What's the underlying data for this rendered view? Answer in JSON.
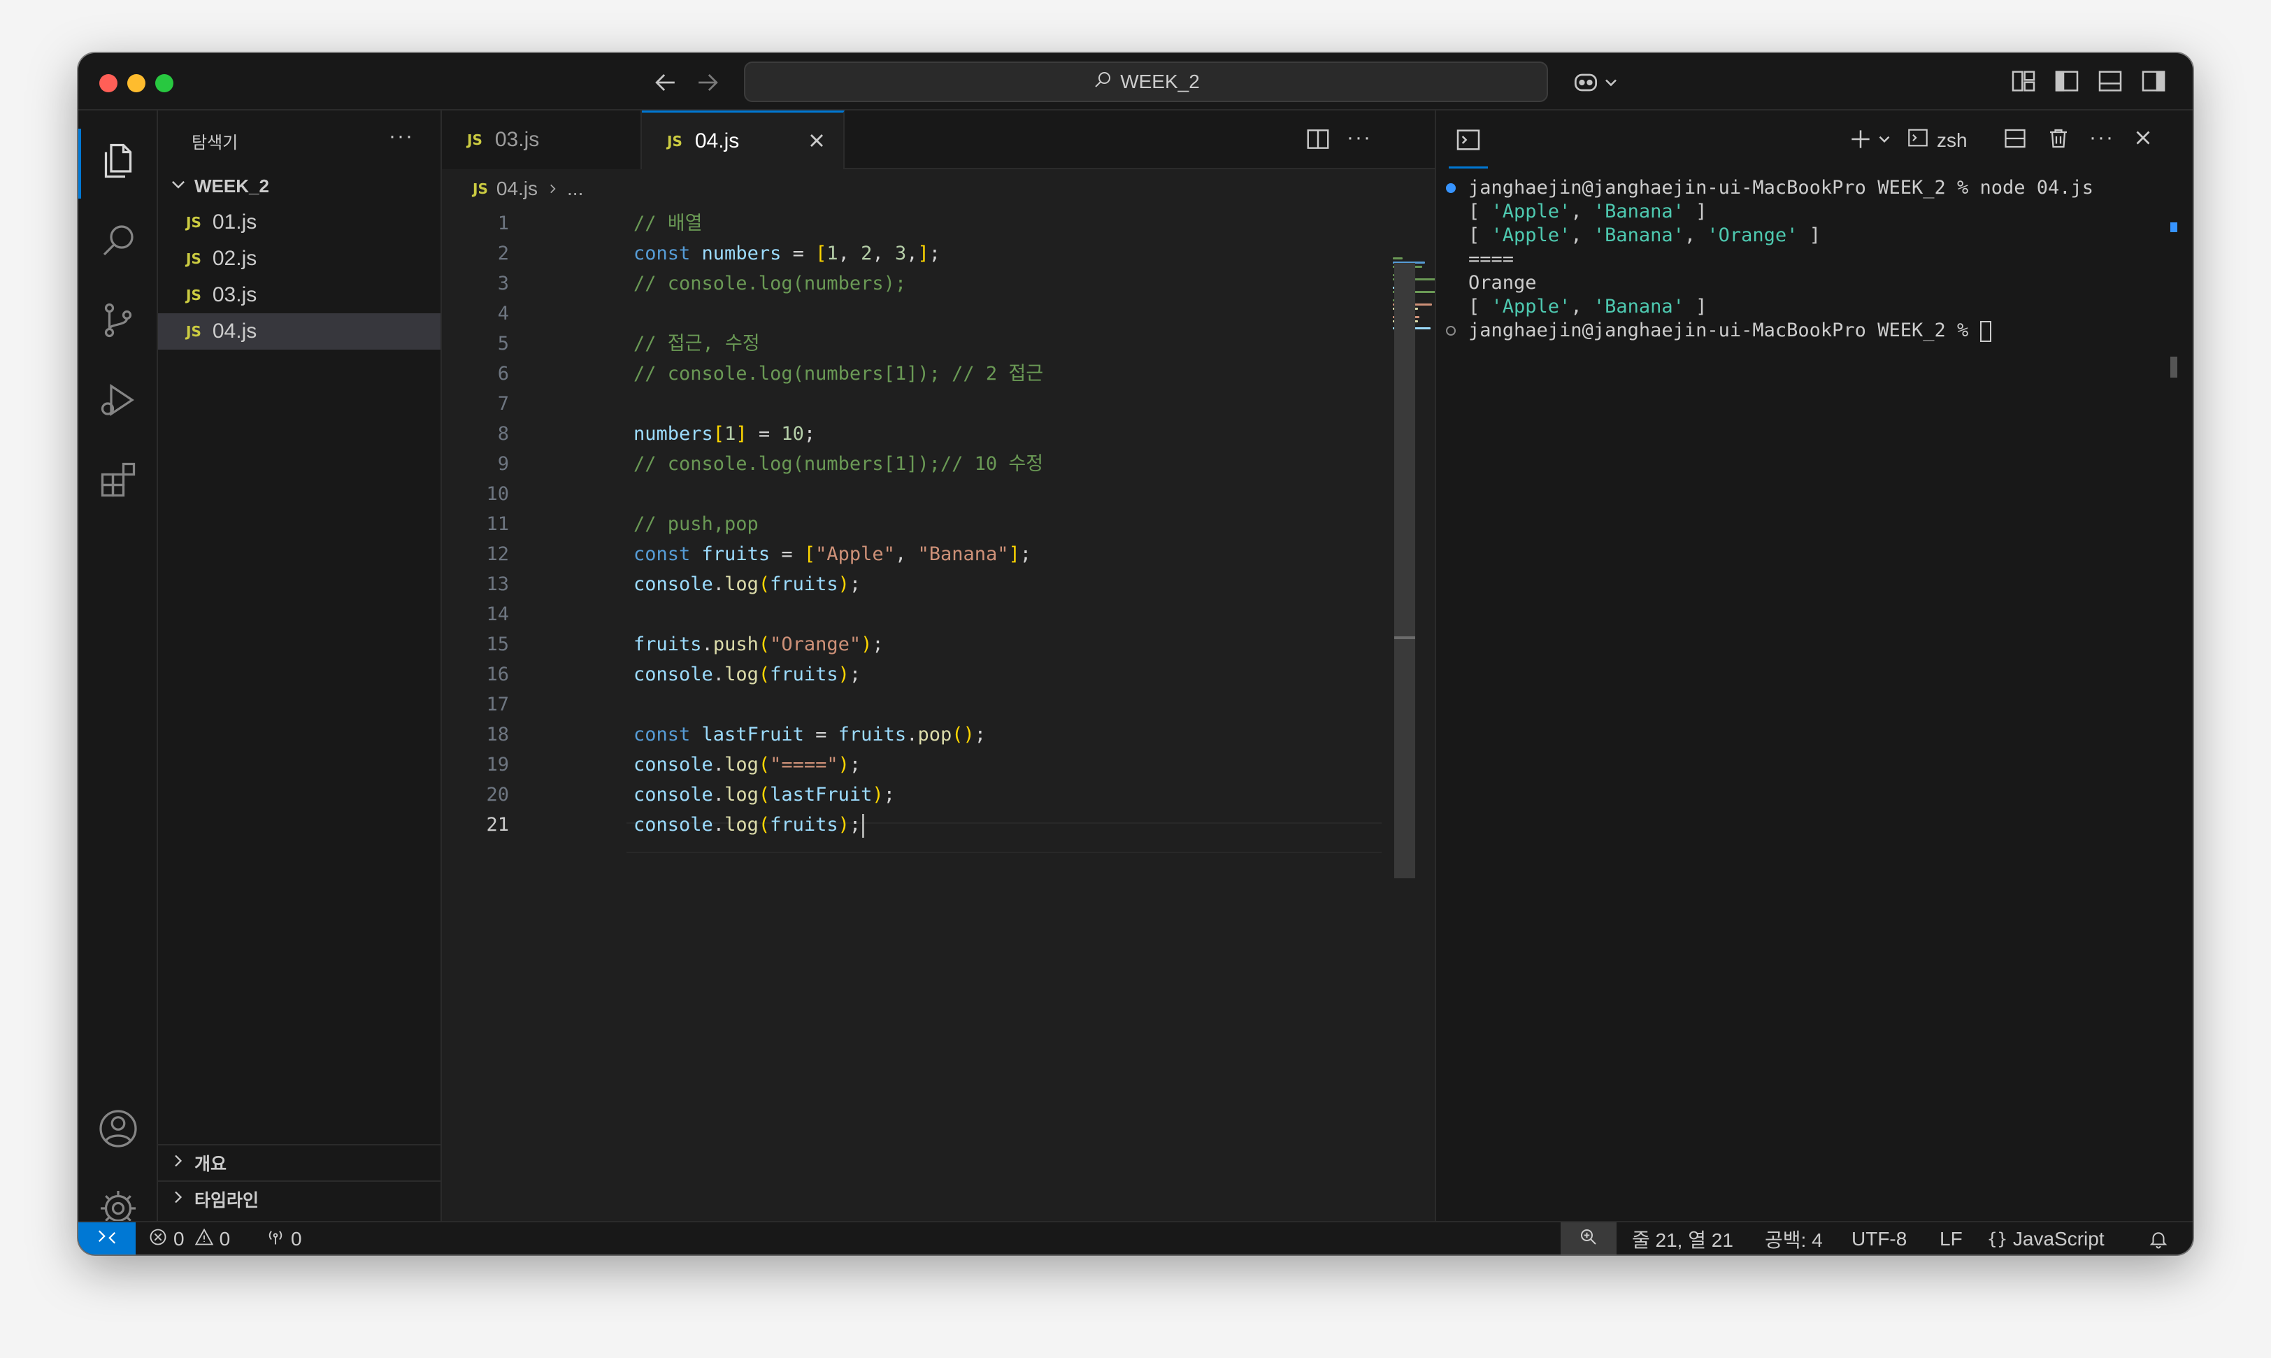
{
  "window": {
    "search_text": "WEEK_2"
  },
  "sidebar": {
    "title": "탐색기",
    "more": "···",
    "folder": "WEEK_2",
    "files": [
      {
        "name": "01.js",
        "badge": "JS"
      },
      {
        "name": "02.js",
        "badge": "JS"
      },
      {
        "name": "03.js",
        "badge": "JS"
      },
      {
        "name": "04.js",
        "badge": "JS",
        "selected": true
      }
    ],
    "sections": [
      "개요",
      "타임라인"
    ]
  },
  "tabs": [
    {
      "label": "03.js",
      "badge": "JS",
      "active": false
    },
    {
      "label": "04.js",
      "badge": "JS",
      "active": true
    }
  ],
  "breadcrumb": {
    "badge": "JS",
    "file": "04.js",
    "rest": "..."
  },
  "editor": {
    "current_line": 21,
    "lines": [
      "// 배열",
      "const numbers = [1, 2, 3,];",
      "// console.log(numbers);",
      "",
      "// 접근, 수정",
      "// console.log(numbers[1]); // 2 접근",
      "",
      "numbers[1] = 10;",
      "// console.log(numbers[1]);// 10 수정",
      "",
      "// push,pop",
      "const fruits = [\"Apple\", \"Banana\"];",
      "console.log(fruits);",
      "",
      "fruits.push(\"Orange\");",
      "console.log(fruits);",
      "",
      "const lastFruit = fruits.pop();",
      "console.log(\"====\");",
      "console.log(lastFruit);",
      "console.log(fruits);"
    ]
  },
  "terminal": {
    "shell": "zsh",
    "lines": [
      "janghaejin@janghaejin-ui-MacBookPro WEEK_2 % node 04.js",
      "[ 'Apple', 'Banana' ]",
      "[ 'Apple', 'Banana', 'Orange' ]",
      "====",
      "Orange",
      "[ 'Apple', 'Banana' ]",
      "janghaejin@janghaejin-ui-MacBookPro WEEK_2 % "
    ]
  },
  "statusbar": {
    "errors": "0",
    "warnings": "0",
    "ports": "0",
    "position": "줄 21, 열 21",
    "indent": "공백: 4",
    "encoding": "UTF-8",
    "eol": "LF",
    "language": "JavaScript"
  },
  "colors": {
    "accent": "#0078d4",
    "comment": "#6a9955",
    "keyword": "#569cd6",
    "variable": "#9cdcfe",
    "function": "#dcdcaa",
    "string": "#ce9178",
    "number": "#b5cea8",
    "js_badge": "#cbcb41"
  },
  "icons": [
    "explorer-icon",
    "search-icon",
    "source-control-icon",
    "run-debug-icon",
    "extensions-icon",
    "account-icon",
    "settings-gear-icon",
    "terminal-icon",
    "copilot-icon",
    "bell-icon",
    "zoom-icon",
    "remote-icon"
  ]
}
